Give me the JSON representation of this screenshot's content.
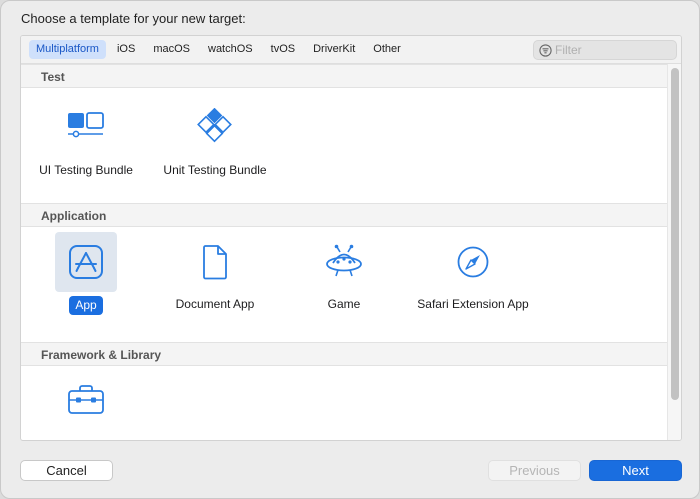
{
  "dialog": {
    "prompt": "Choose a template for your new target:"
  },
  "tabs": [
    {
      "label": "Multiplatform",
      "active": true
    },
    {
      "label": "iOS",
      "active": false
    },
    {
      "label": "macOS",
      "active": false
    },
    {
      "label": "watchOS",
      "active": false
    },
    {
      "label": "tvOS",
      "active": false
    },
    {
      "label": "DriverKit",
      "active": false
    },
    {
      "label": "Other",
      "active": false
    }
  ],
  "filter": {
    "placeholder": "Filter",
    "icon": "filter-icon"
  },
  "sections": [
    {
      "title": "Test",
      "items": [
        {
          "label": "UI Testing Bundle",
          "icon": "ui-testing-bundle-icon"
        },
        {
          "label": "Unit Testing Bundle",
          "icon": "unit-testing-bundle-icon"
        }
      ]
    },
    {
      "title": "Application",
      "items": [
        {
          "label": "App",
          "icon": "app-store-icon",
          "selected": true
        },
        {
          "label": "Document App",
          "icon": "document-icon"
        },
        {
          "label": "Game",
          "icon": "game-icon"
        },
        {
          "label": "Safari Extension App",
          "icon": "compass-icon"
        }
      ]
    },
    {
      "title": "Framework & Library",
      "items": [
        {
          "label": "",
          "icon": "toolbox-icon"
        }
      ]
    }
  ],
  "buttons": {
    "cancel": "Cancel",
    "previous": "Previous",
    "next": "Next"
  },
  "colors": {
    "accent": "#1a6ee0",
    "icon_blue": "#2a7de1",
    "selected_tile": "#dfe6ef"
  }
}
